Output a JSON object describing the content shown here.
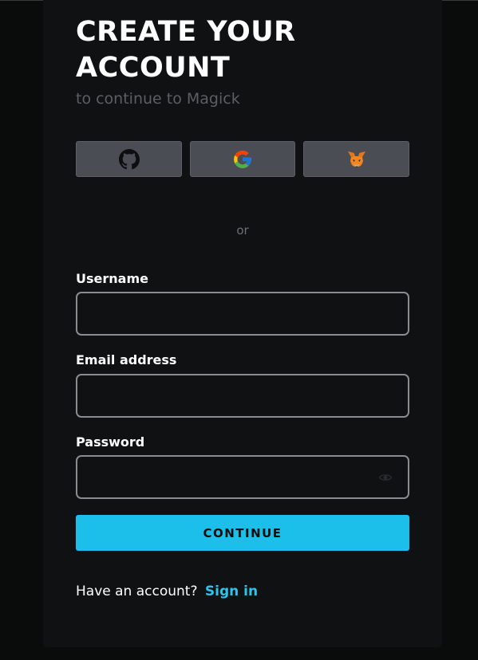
{
  "header": {
    "title": "CREATE YOUR ACCOUNT",
    "subtitle": "to continue to Magick"
  },
  "social": [
    {
      "provider": "github",
      "icon": "github-icon"
    },
    {
      "provider": "google",
      "icon": "google-icon"
    },
    {
      "provider": "metamask",
      "icon": "metamask-fox-icon"
    }
  ],
  "divider": {
    "text": "or"
  },
  "form": {
    "username": {
      "label": "Username",
      "value": "",
      "placeholder": ""
    },
    "email": {
      "label": "Email address",
      "value": "",
      "placeholder": ""
    },
    "password": {
      "label": "Password",
      "value": "",
      "placeholder": "",
      "toggle_icon": "eye-icon"
    }
  },
  "actions": {
    "continue_label": "CONTINUE"
  },
  "footer": {
    "prompt": "Have an account?",
    "signin_label": "Sign in"
  },
  "colors": {
    "background": "#0a0b0b",
    "card": "#0f1113",
    "accent": "#1bbfe9",
    "link": "#2ec3ec",
    "social_button": "#4a4e54"
  }
}
